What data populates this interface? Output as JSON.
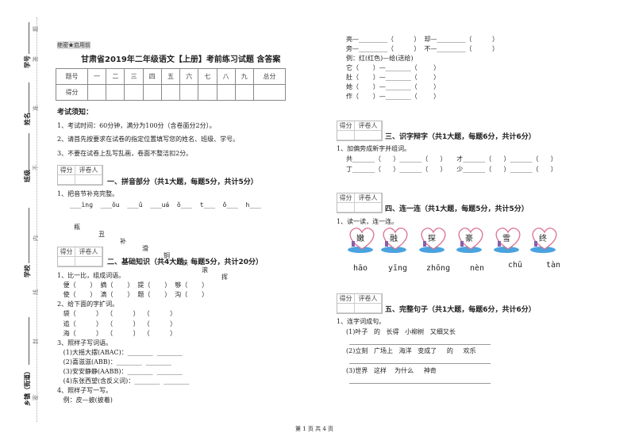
{
  "margin": {
    "labels": [
      "学号",
      "姓名",
      "班级",
      "学校",
      "乡镇（街道）"
    ],
    "seal_chars": [
      "题",
      "答",
      "准",
      "不",
      "内",
      "线",
      "封",
      "密"
    ]
  },
  "header": {
    "secret": "绝密★启用前",
    "title": "甘肃省2019年二年级语文【上册】考前练习试题 含答案"
  },
  "score_table": {
    "row1": [
      "题号",
      "一",
      "二",
      "三",
      "四",
      "五",
      "六",
      "七",
      "八",
      "九",
      "总分"
    ],
    "row2_label": "得分"
  },
  "notice": {
    "title": "考试须知：",
    "items": [
      "1、考试时间：60分钟，满分为100分（含卷面分2分）。",
      "2、请首先按要求在试卷的指定位置填写您的姓名、班级、学号。",
      "3、不要在试卷上乱写乱画，卷面不整洁扣2分。"
    ]
  },
  "grader": {
    "score": "得分",
    "reviewer": "评卷人"
  },
  "s1": {
    "title": "一、拼音部分（共1大题，每题5分，共计5分）",
    "q1": "1、把音节补充完整。",
    "pinyin": "___ìnɡ  ___ǒu  ___ǔ  ___uá  ǒ___  t___  ǒ___  h___",
    "chars": [
      "瓶",
      "丑",
      "补",
      "滑",
      "铜",
      "铁",
      "滚",
      "挥"
    ]
  },
  "s2": {
    "title": "二、基础知识（共4大题，每题5分，共计20分）",
    "lines": [
      "1、比一比，组成词语。",
      "   便（       ）  摘（       ）  提（       ）  够（       ）",
      "   使（       ）  滴（       ）  题（       ）  沟（       ）",
      "2、给下面的字扩词。",
      "   袋（          ）  （          ）  （          ）",
      "   追（          ）  （          ）  （          ）",
      "   海（          ）  （          ）  （          ）",
      "3、照样子写词语。",
      "   (1)大摇大摆(ABAC)：________  ________",
      "   (2)喜滋滋(ABB)：________  ________",
      "   (3)安安静静(AABB)：________  ________",
      "   (4)东张西望(含反义词)：________  ________",
      "4、照样子写一写。",
      "   例：皮—披(披着)"
    ]
  },
  "right_top": {
    "lines": [
      "亮—_________（          ）  却—_________（          ）",
      "旁—_________（          ）  不—_________（          ）",
      "例：红(红色)—给(送给)",
      "它（       ）—________（        ）",
      "肚（       ）—________（        ）",
      "她（       ）—________（        ）",
      "作（       ）—________（        ）"
    ]
  },
  "s3": {
    "title": "三、识字辩字（共1大题，每题6分，共计6分）",
    "q1": "1、加偏旁成新字并组词。",
    "rows": [
      "共_______（      ）_______（      ）     才_______（      ）_______（      ）",
      "丁_______（      ）_______（      ）     少_______（      ）_______（      ）"
    ]
  },
  "s4": {
    "title": "四、连一连（共1大题，每题5分，共计5分）",
    "q1": "1、读一读，连一连。",
    "hearts": [
      "嫩",
      "融",
      "探",
      "豪",
      "雪",
      "终"
    ],
    "pinyin": [
      "hāo",
      "yīng",
      "zhōng",
      "nèn",
      "chū",
      "tàn"
    ]
  },
  "s5": {
    "title": "五、完整句子（共1大题，每题6分，共计6分）",
    "q1": "1、连字词成句。",
    "items": [
      "(1)叶子   的   长得   小柳树   又细又长",
      "(2)立刻   广场上   海洋   变成了     的     欢乐",
      "(3)世界   这样    为什么     神奇"
    ]
  },
  "footer": {
    "page": "第 1 页 共 4 页"
  }
}
